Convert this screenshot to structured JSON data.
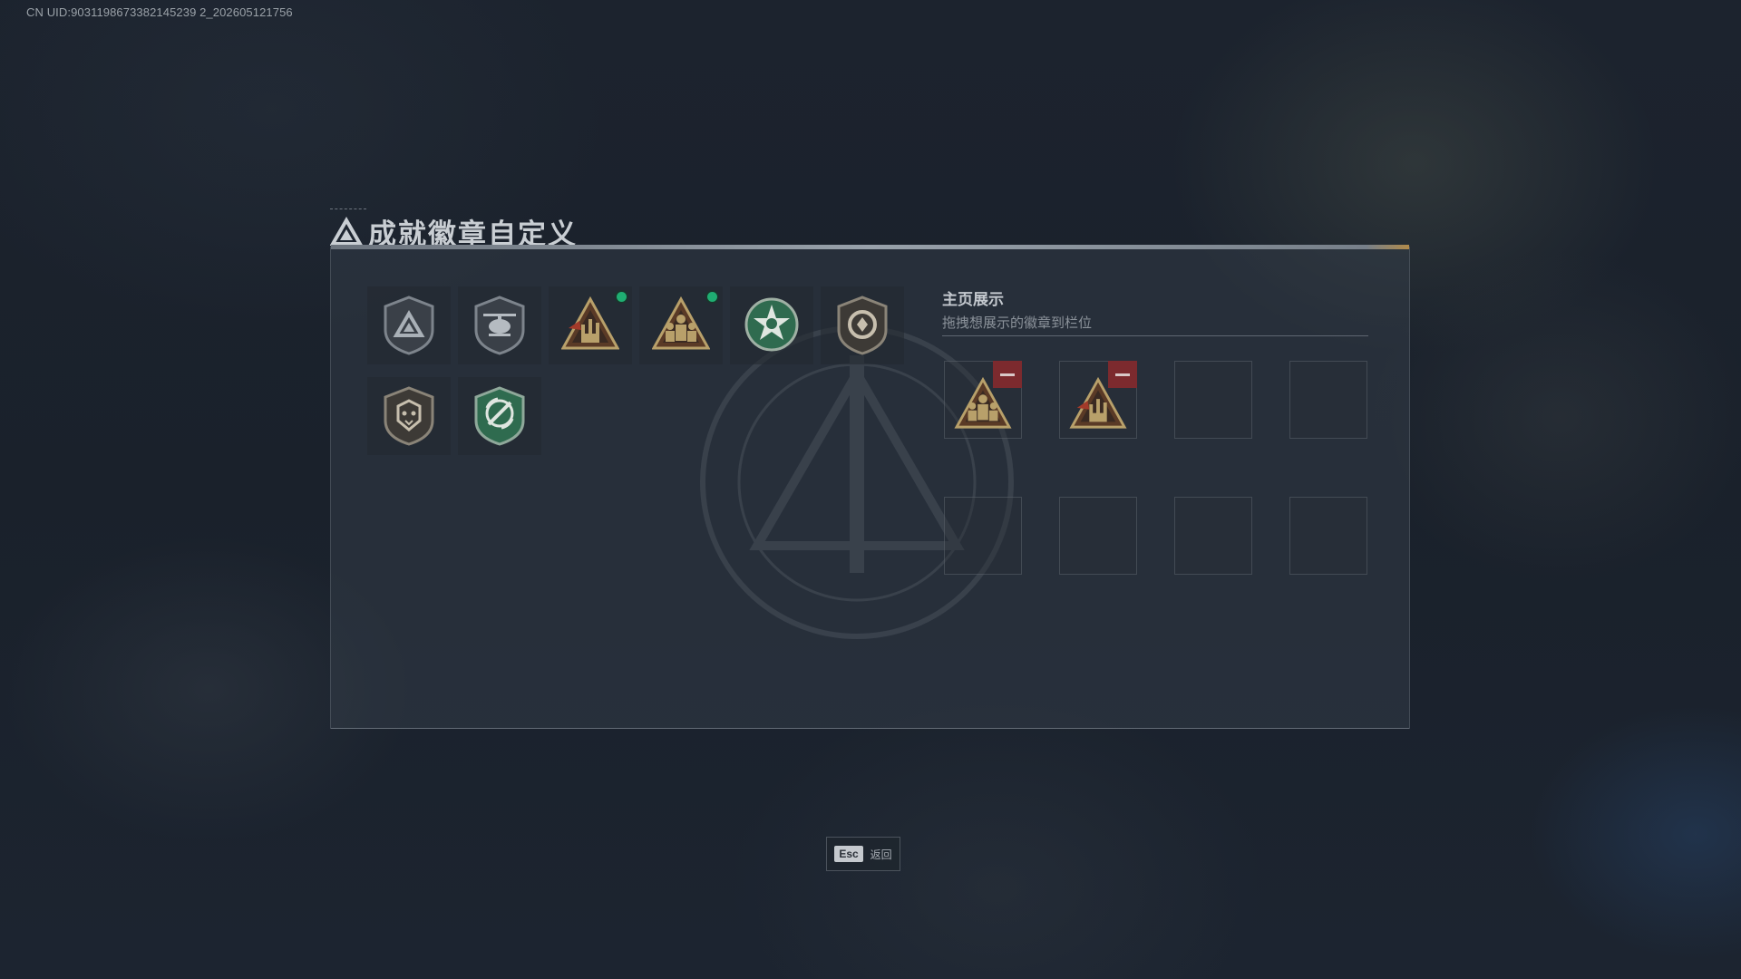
{
  "uid_text": "CN UID:9031198673382145239 2_202605121756",
  "title": "成就徽章自定义",
  "badges": [
    {
      "icon": "triangle-shield-badge-icon",
      "equipped": false
    },
    {
      "icon": "helicopter-shield-badge-icon",
      "equipped": false
    },
    {
      "icon": "rock-hand-triangle-badge-icon",
      "equipped": true
    },
    {
      "icon": "team-triangle-badge-icon",
      "equipped": true
    },
    {
      "icon": "green-star-medal-badge-icon",
      "equipped": false
    },
    {
      "icon": "round-shield-badge-icon",
      "equipped": false
    },
    {
      "icon": "lion-shield-badge-icon",
      "equipped": false
    },
    {
      "icon": "green-wreath-badge-icon",
      "equipped": false
    }
  ],
  "showcase": {
    "title": "主页展示",
    "subtitle": "拖拽想展示的徽章到栏位",
    "slots": [
      {
        "icon": "team-triangle-badge-icon",
        "filled": true
      },
      {
        "icon": "rock-hand-triangle-badge-icon",
        "filled": true
      },
      {
        "filled": false
      },
      {
        "filled": false
      },
      {
        "filled": false
      },
      {
        "filled": false
      },
      {
        "filled": false
      },
      {
        "filled": false
      }
    ]
  },
  "esc_hint": {
    "key": "Esc",
    "label": "返回"
  },
  "colors": {
    "equipped_dot": "#1fae72",
    "remove_button": "#7c2a2e",
    "badge_gold": "#b8a06a",
    "badge_green": "#2f6b4f"
  }
}
